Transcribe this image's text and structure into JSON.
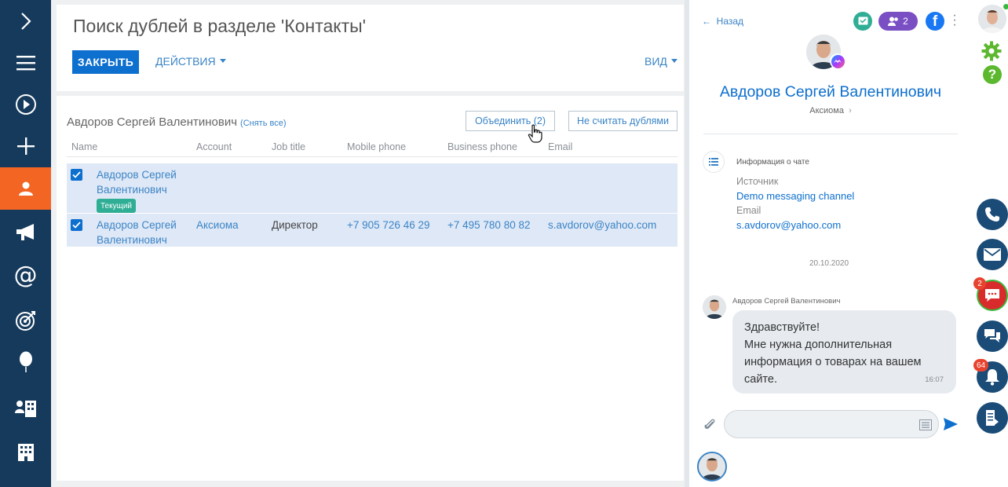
{
  "main": {
    "title": "Поиск дублей в разделе 'Контакты'",
    "close_label": "ЗАКРЫТЬ",
    "actions_label": "ДЕЙСТВИЯ",
    "view_label": "ВИД"
  },
  "group": {
    "name": "Авдоров Сергей Валентинович",
    "unselect_label": "(Снять все)",
    "merge_label": "Объединить (2)",
    "not_duplicates_label": "Не считать дублями"
  },
  "table": {
    "columns": [
      "Name",
      "Account",
      "Job title",
      "Mobile phone",
      "Business phone",
      "Email"
    ],
    "rows": [
      {
        "name_line1": "Авдоров Сергей",
        "name_line2": "Валентинович",
        "badge": "Текущий",
        "account": "",
        "job": "",
        "mobile": "",
        "business": "",
        "email": "",
        "checked": true
      },
      {
        "name_line1": "Авдоров Сергей",
        "name_line2": "Валентинович",
        "badge": "",
        "account": "Аксиома",
        "job": "Директор",
        "mobile": "+7 905 726 46 29",
        "business": "+7 495 780 80 82",
        "email": "s.avdorov@yahoo.com",
        "checked": true
      }
    ]
  },
  "chat": {
    "back_label": "Назад",
    "participants_count": "2",
    "contact_name": "Авдоров Сергей Валентинович",
    "contact_account": "Аксиома",
    "info_title": "Информация о чате",
    "source_label": "Источник",
    "source_value": "Demo messaging channel",
    "email_label": "Email",
    "email_value": "s.avdorov@yahoo.com",
    "date": "20.10.2020",
    "message_author": "Авдоров Сергей Валентинович",
    "message_lines": [
      "Здравствуйте!",
      "Мне нужна дополнительная",
      "информация о товарах на вашем",
      "сайте."
    ],
    "message_time": "16:07"
  },
  "rightbar": {
    "chat_badge": "2",
    "notifications_badge": "64"
  },
  "colors": {
    "sidebar": "#163a5c",
    "active": "#f26522",
    "accent": "#0d6fce",
    "link": "#3a84c6",
    "selected_row": "#dfe8f6",
    "badge_green": "#2fae95",
    "alert": "#e8432e"
  },
  "icons": {
    "left_nav": [
      "chevron-right-icon",
      "menu-icon",
      "play-icon",
      "plus-icon",
      "contact-icon",
      "megaphone-icon",
      "at-icon",
      "target-icon",
      "balloon-icon",
      "org-icon",
      "building-icon"
    ],
    "right_bar": [
      "phone-icon",
      "email-icon",
      "chat-icon",
      "feed-icon",
      "bell-icon",
      "document-icon"
    ]
  }
}
